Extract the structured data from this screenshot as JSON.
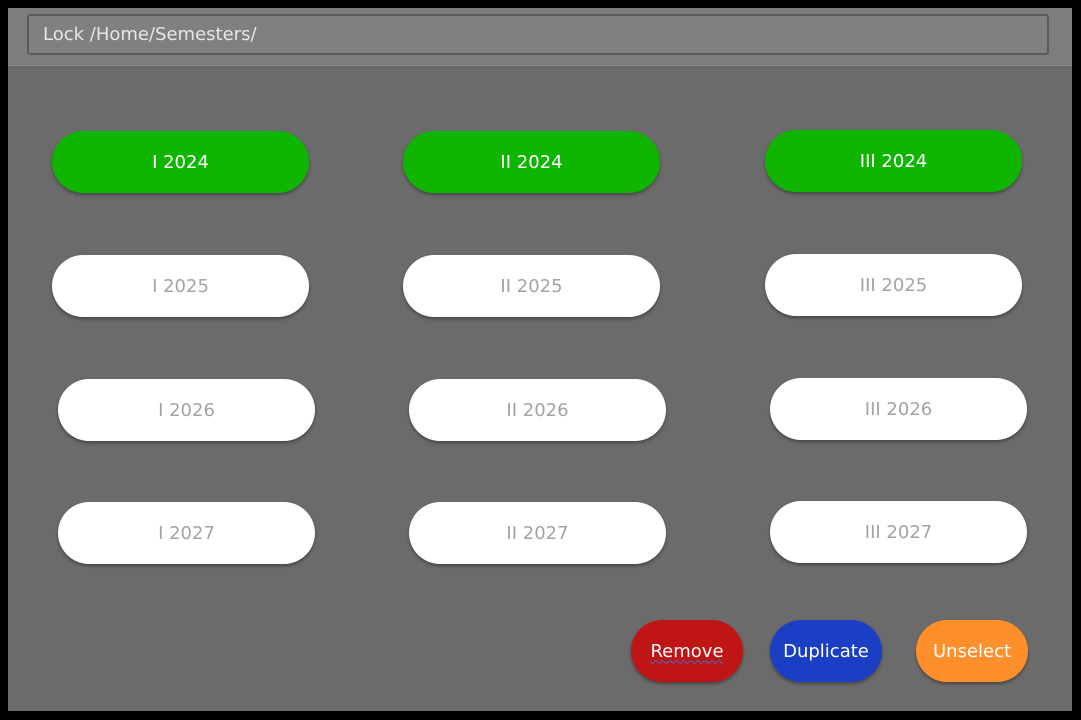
{
  "path_bar": {
    "text": "Lock /Home/Semesters/"
  },
  "semesters": {
    "row_2024": [
      "I 2024",
      "II 2024",
      "III 2024"
    ],
    "row_2025": [
      "I 2025",
      "II 2025",
      "III 2025"
    ],
    "row_2026": [
      "I 2026",
      "II 2026",
      "III 2026"
    ],
    "row_2027": [
      "I 2027",
      "II 2027",
      "III 2027"
    ],
    "selected_color": "#0fb500",
    "unselected_color": "#ffffff"
  },
  "actions": {
    "remove_label": "Remove",
    "duplicate_label": "Duplicate",
    "unselect_label": "Unselect",
    "remove_color": "#c01515",
    "duplicate_color": "#1a3fc4",
    "unselect_color": "#ff8f2a"
  }
}
